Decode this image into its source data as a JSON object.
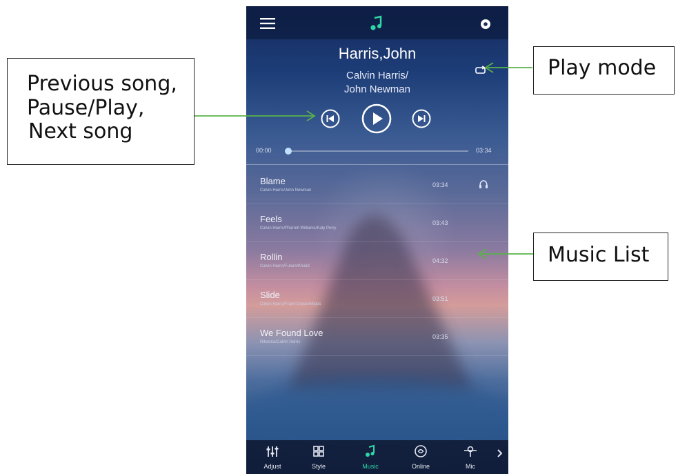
{
  "callouts": {
    "controls_line1": "Previous song,",
    "controls_line2": "Pause/Play,",
    "controls_line3": "Next song",
    "play_mode": "Play mode",
    "music_list": "Music List"
  },
  "colors": {
    "arrow": "#59b248",
    "accent": "#2fd6a6"
  },
  "header": {
    "menu_icon": "menu-icon",
    "logo_icon": "music-note-logo-icon",
    "settings_icon": "gear-icon"
  },
  "now_playing": {
    "title": "Harris,John",
    "artist_line1": "Calvin Harris/",
    "artist_line2": "John Newman",
    "play_mode_icon": "repeat-icon",
    "elapsed": "00:00",
    "total": "03:34",
    "progress": 0.02
  },
  "music_list": [
    {
      "title": "Blame",
      "artist": "Calvin Harris/John Newman",
      "duration": "03:34",
      "playing": true
    },
    {
      "title": "Feels",
      "artist": "Calvin Harris/Pharrell Williams/Katy Perry",
      "duration": "03:43"
    },
    {
      "title": "Rollin",
      "artist": "Calvin Harris/Future/Khalid",
      "duration": "04:32"
    },
    {
      "title": "Slide",
      "artist": "Calvin Harris/Frank Ocean/Migos",
      "duration": "03:51"
    },
    {
      "title": "We Found Love",
      "artist": "Rihanna/Calvin Harris",
      "duration": "03:35"
    }
  ],
  "bottom_nav": [
    {
      "label": "Adjust",
      "icon": "sliders-icon"
    },
    {
      "label": "Style",
      "icon": "grid-icon"
    },
    {
      "label": "Music",
      "icon": "music-note-icon",
      "active": true
    },
    {
      "label": "Online",
      "icon": "online-icon"
    },
    {
      "label": "Mic",
      "icon": "microphone-icon"
    }
  ]
}
